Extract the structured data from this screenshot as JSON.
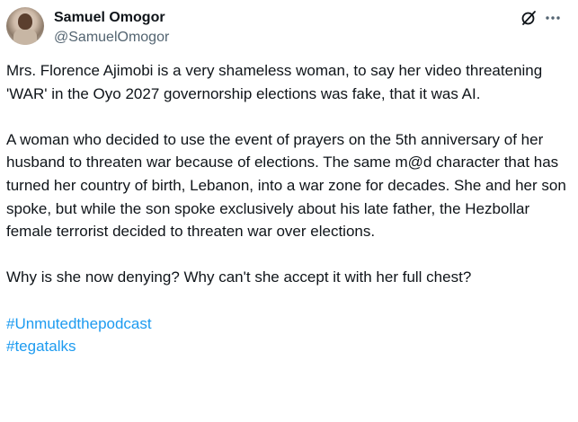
{
  "author": {
    "display_name": "Samuel Omogor",
    "handle": "@SamuelOmogor"
  },
  "header_icons": {
    "grok": "grok-icon",
    "more": "more-options-icon"
  },
  "tweet": {
    "paragraphs": [
      "Mrs. Florence Ajimobi is a very shameless woman, to say her video threatening 'WAR' in the Oyo 2027 governorship elections was fake, that it was AI.",
      "A woman who decided to use the event of prayers on the 5th anniversary of her husband to threaten war because of  elections. The same m@d character that has turned her country of birth, Lebanon, into a war zone for decades. She and her son spoke, but while the son spoke exclusively about his late father, the Hezbollar female terrorist decided to threaten war over elections.",
      "Why is she now denying? Why can't she accept it with her full chest?"
    ],
    "hashtags": [
      "#Unmutedthepodcast",
      "#tegatalks"
    ]
  },
  "colors": {
    "text": "#0f1419",
    "secondary": "#536471",
    "link": "#1d9bf0"
  }
}
